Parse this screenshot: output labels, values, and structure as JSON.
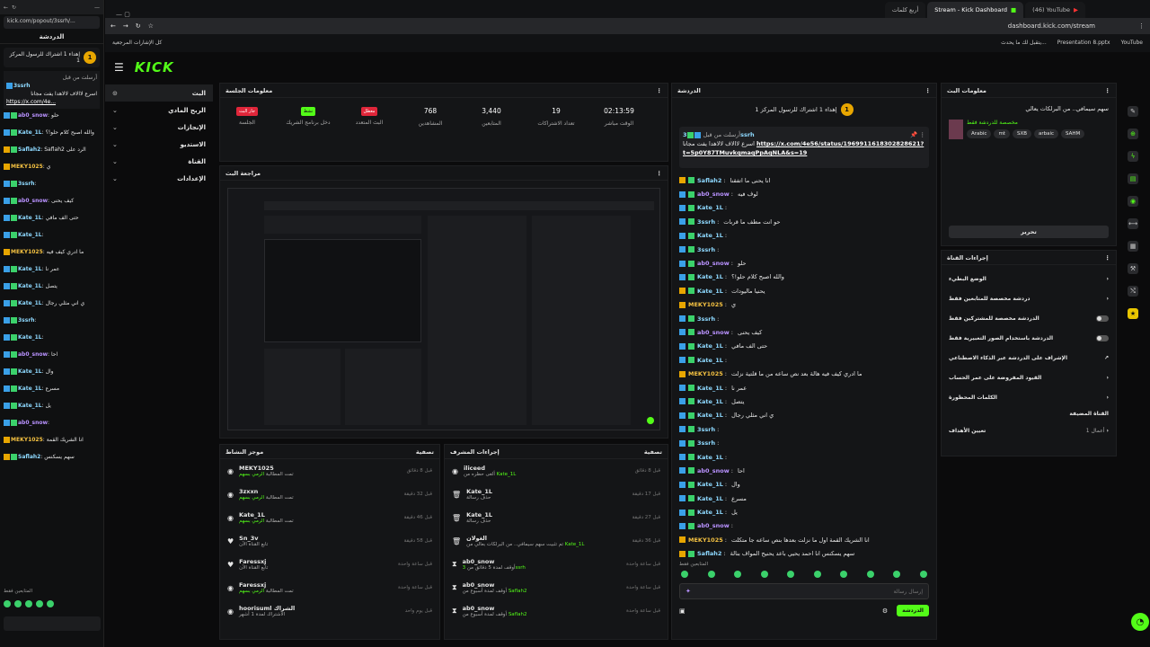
{
  "popout": {
    "url": "kick.com/popout/3ssrh/...",
    "header": "الدردشة",
    "pinned_title": "إهداء 1 اشتراك للرسول المركز 1",
    "pinned_by": "أرسلت من قبل",
    "pinned_user": "3ssrh",
    "pinned_text": "اسرع لاالاف لالاهدا يفت مجانا",
    "pinned_link": "https://x.com/4e...",
    "messages": [
      {
        "c": "b",
        "u": "ab0_snow",
        "m": "حلو"
      },
      {
        "c": "b",
        "u": "Kate_1L",
        "m": "والله اصبح كلام حلو!؟"
      },
      {
        "c": "r",
        "u": "Saflah2",
        "m": "Saflah2 الرد على"
      },
      {
        "c": "g",
        "u": "MEKY1025",
        "m": "ي"
      },
      {
        "c": "b",
        "u": "3ssrh",
        "m": ""
      },
      {
        "c": "b",
        "u": "ab0_snow",
        "m": "كيف يحنى"
      },
      {
        "c": "b",
        "u": "Kate_1L",
        "m": "حتى الف مافي"
      },
      {
        "c": "b",
        "u": "Kate_1L",
        "m": ""
      },
      {
        "c": "g",
        "u": "MEKY1025",
        "m": "ما ادري كيف فيه"
      },
      {
        "c": "b",
        "u": "Kate_1L",
        "m": "عمر نا"
      },
      {
        "c": "b",
        "u": "Kate_1L",
        "m": "يتصل"
      },
      {
        "c": "b",
        "u": "Kate_1L",
        "m": "ي اني مثلي رجال"
      },
      {
        "c": "b",
        "u": "3ssrh",
        "m": ""
      },
      {
        "c": "b",
        "u": "Kate_1L",
        "m": ""
      },
      {
        "c": "b",
        "u": "ab0_snow",
        "m": "احا"
      },
      {
        "c": "b",
        "u": "Kate_1L",
        "m": "وال"
      },
      {
        "c": "b",
        "u": "Kate_1L",
        "m": "مسرع"
      },
      {
        "c": "b",
        "u": "Kate_1L",
        "m": "يل"
      },
      {
        "c": "b",
        "u": "ab0_snow",
        "m": ""
      },
      {
        "c": "g",
        "u": "MEKY1025",
        "m": "انا الشريك القمة"
      },
      {
        "c": "r",
        "u": "Saflah2",
        "m": "سهم يسكنس"
      }
    ],
    "footer": "المتابعين فقط"
  },
  "browser": {
    "tabs": [
      "أربع كلمات",
      "Stream - Kick Dashboard",
      "(46) YouTube"
    ],
    "url": "dashboard.kick.com/stream",
    "bookmarks_left": "كل الإشارات المرجعية",
    "bookmarks": [
      "يتقبل لك ما يحدث...",
      "Presentation 8.pptx",
      "YouTube"
    ]
  },
  "logo": "KICK",
  "nav": [
    {
      "label": "البث",
      "active": true
    },
    {
      "label": "الربح المادي"
    },
    {
      "label": "الإنجازات"
    },
    {
      "label": "الاستديو"
    },
    {
      "label": "القناة"
    },
    {
      "label": "الإعدادات"
    }
  ],
  "session": {
    "title": "معلومات الجلسة",
    "stats": [
      {
        "label": "الجلسة",
        "badge": "جار البث",
        "bc": "#e0263a"
      },
      {
        "label": "دخل برنامج الشريك",
        "badge": "نشط",
        "bc": "#53fc18"
      },
      {
        "label": "البث المتعدد",
        "badge": "معطل",
        "bc": "#e0263a"
      },
      {
        "label": "المشاهدين",
        "value": "768"
      },
      {
        "label": "المتابعين",
        "value": "3,440"
      },
      {
        "label": "تعداد الاشتراكات",
        "value": "19"
      },
      {
        "label": "الوقت مباشر",
        "value": "02:13:59"
      }
    ]
  },
  "preview": {
    "title": "مراجعة البث"
  },
  "activity": {
    "title": "موجز النشاط",
    "filter": "تصفية",
    "items": [
      {
        "name": "MEKY1025",
        "sub": "تمت المطالبة",
        "hl": "الرمي بسهم",
        "time": "قبل 8 دقائق"
      },
      {
        "name": "3zxxn",
        "sub": "تمت المطالبة",
        "hl": "الرمي بسهم",
        "time": "قبل 32 دقيقة"
      },
      {
        "name": "Kate_1L",
        "sub": "تمت المطالبة",
        "hl": "الرمي بسهم",
        "time": "قبل 46 دقيقة"
      },
      {
        "name": "Sn_3v",
        "sub": "تابع القناة الآن",
        "hl": "",
        "time": "قبل 58 دقيقة"
      },
      {
        "name": "Faressxj",
        "sub": "تابع القناة الآن",
        "hl": "",
        "time": "قبل ساعة واحدة"
      },
      {
        "name": "Faressxj",
        "sub": "تمت المطالبة",
        "hl": "الرمي بسهم",
        "time": "قبل ساعة واحدة"
      },
      {
        "name": "hoorisuml الشراك",
        "sub": "الاشتراك لمدة 1 أشهر",
        "hl": "",
        "time": "قبل يوم واحد"
      }
    ]
  },
  "modactions": {
    "title": "إجراءات المشرف",
    "filter": "تصفية",
    "items": [
      {
        "name": "iliceed",
        "sub": "ألغى حظره من",
        "hl": "Kate_1L",
        "time": "قبل 8 دقائق"
      },
      {
        "name": "Kate_1L",
        "sub": "حذف رسالة",
        "hl": "",
        "time": "قبل 17 دقيقة"
      },
      {
        "name": "Kate_1L",
        "sub": "حذف رسالة",
        "hl": "",
        "time": "قبل 27 دقيقة"
      },
      {
        "name": "الغولان",
        "sub": "تم تثبيت سهم سيمافي.. من البرلكات بعالي من",
        "hl": "Kate_1L",
        "time": "قبل 36 دقيقة"
      },
      {
        "name": "ab0_snow",
        "sub": "أوقف لمدة 5 دقائق من",
        "hl": "3ssrh",
        "time": "قبل ساعة واحدة"
      },
      {
        "name": "ab0_snow",
        "sub": "أوقف لمدة أسبوع من",
        "hl": "Saflah2",
        "time": "قبل ساعة واحدة"
      },
      {
        "name": "ab0_snow",
        "sub": "أوقف لمدة أسبوع من",
        "hl": "Saflah2",
        "time": "قبل ساعة واحدة"
      }
    ]
  },
  "chat": {
    "title": "الدردشة",
    "pinned_gift": "إهداء 1 اشتراك للرسول المركز 1",
    "pinned_by": "أرسلت من قبل",
    "pinned_user": "3ssrh",
    "pinned_text": "اسرع لاالاف لالاهدا يفت مجانا",
    "pinned_link": "https://x.com/4e56/status/1969911618302828621?t=5p0Y87TMuvkqmaqPpAqNLA&s=19",
    "messages": [
      {
        "u": "Saflah2",
        "m": "انا يحنى ما اتفقنا",
        "c": "r"
      },
      {
        "u": "ab0_snow",
        "m": "لوف فيه",
        "c": "b"
      },
      {
        "u": "Kate_1L",
        "m": "",
        "c": "b"
      },
      {
        "u": "3ssrh",
        "m": "حو انت مطف ما قربات",
        "c": "b"
      },
      {
        "u": "Kate_1L",
        "m": "",
        "c": "b"
      },
      {
        "u": "3ssrh",
        "m": "",
        "c": "b"
      },
      {
        "u": "ab0_snow",
        "m": "حلو",
        "c": "b"
      },
      {
        "u": "Kate_1L",
        "m": "والله اصبح كلام حلو!؟",
        "c": "b"
      },
      {
        "u": "Kate_1L",
        "m": "يحنيا ماليودات",
        "c": "r"
      },
      {
        "u": "MEKY1025",
        "m": "ي",
        "c": "g"
      },
      {
        "u": "3ssrh",
        "m": "",
        "c": "b"
      },
      {
        "u": "ab0_snow",
        "m": "كيف يحنى",
        "c": "b"
      },
      {
        "u": "Kate_1L",
        "m": "حتى الف مافي",
        "c": "b"
      },
      {
        "u": "Kate_1L",
        "m": "",
        "c": "b"
      },
      {
        "u": "MEKY1025",
        "m": "ما ادري كيف فيه هالة بعد نص ساعه من ما قلتية نزلت",
        "c": "g"
      },
      {
        "u": "Kate_1L",
        "m": "عمر نا",
        "c": "b"
      },
      {
        "u": "Kate_1L",
        "m": "يتصل",
        "c": "b"
      },
      {
        "u": "Kate_1L",
        "m": "ي اني مثلي رجال",
        "c": "b"
      },
      {
        "u": "3ssrh",
        "m": "",
        "c": "b"
      },
      {
        "u": "3ssrh",
        "m": "",
        "c": "b"
      },
      {
        "u": "Kate_1L",
        "m": "",
        "c": "b"
      },
      {
        "u": "ab0_snow",
        "m": "احا",
        "c": "b"
      },
      {
        "u": "Kate_1L",
        "m": "وال",
        "c": "b"
      },
      {
        "u": "Kate_1L",
        "m": "مسرع",
        "c": "b"
      },
      {
        "u": "Kate_1L",
        "m": "يل",
        "c": "b"
      },
      {
        "u": "ab0_snow",
        "m": "",
        "c": "b"
      },
      {
        "u": "MEKY1025",
        "m": "انا الشريك القمة اول ما نزلت بعدها بنص ساعه جا متكلت",
        "c": "g"
      },
      {
        "u": "Saflah2",
        "m": "سهم يسكنس انا احمد يحيي باعد يحنيح المواف بنالة",
        "c": "r"
      }
    ],
    "followers_only": "المتابعين فقط",
    "input_placeholder": "إرسال رسالة",
    "send": "الدردشة"
  },
  "streaminfo": {
    "title": "معلومات البث",
    "stream_title": "سهم سيمافي.. من البرلكات يعالي",
    "category": "مخصصة للدردشة فقط",
    "tags": [
      "Arabic",
      "mt",
      "SXB",
      "arbaic",
      "SAHM"
    ],
    "edit": "تحرير"
  },
  "channelactions": {
    "title": "إجراءات القناة",
    "items": [
      {
        "label": "الوضع البطيء",
        "ctl": "arrow"
      },
      {
        "label": "دردشة مخصصة للمتابعين فقط",
        "ctl": "arrow"
      },
      {
        "label": "الدردشة مخصصة للمشتركين فقط",
        "ctl": "toggle"
      },
      {
        "label": "الدردشة باستخدام الصور التعبيرية فقط",
        "ctl": "toggle"
      },
      {
        "label": "الإشراف على الدردشة عبر الذكاء الاصطناعي",
        "ctl": "ext"
      },
      {
        "label": "القيود المفروضة على عمر الحساب",
        "ctl": "arrow"
      },
      {
        "label": "الكلمات المحظورة",
        "ctl": "arrow"
      }
    ],
    "hosting_label": "القناة المضيفة",
    "hosting_item": "تعيين الأهداف",
    "hosting_value": "أعمال 1"
  }
}
